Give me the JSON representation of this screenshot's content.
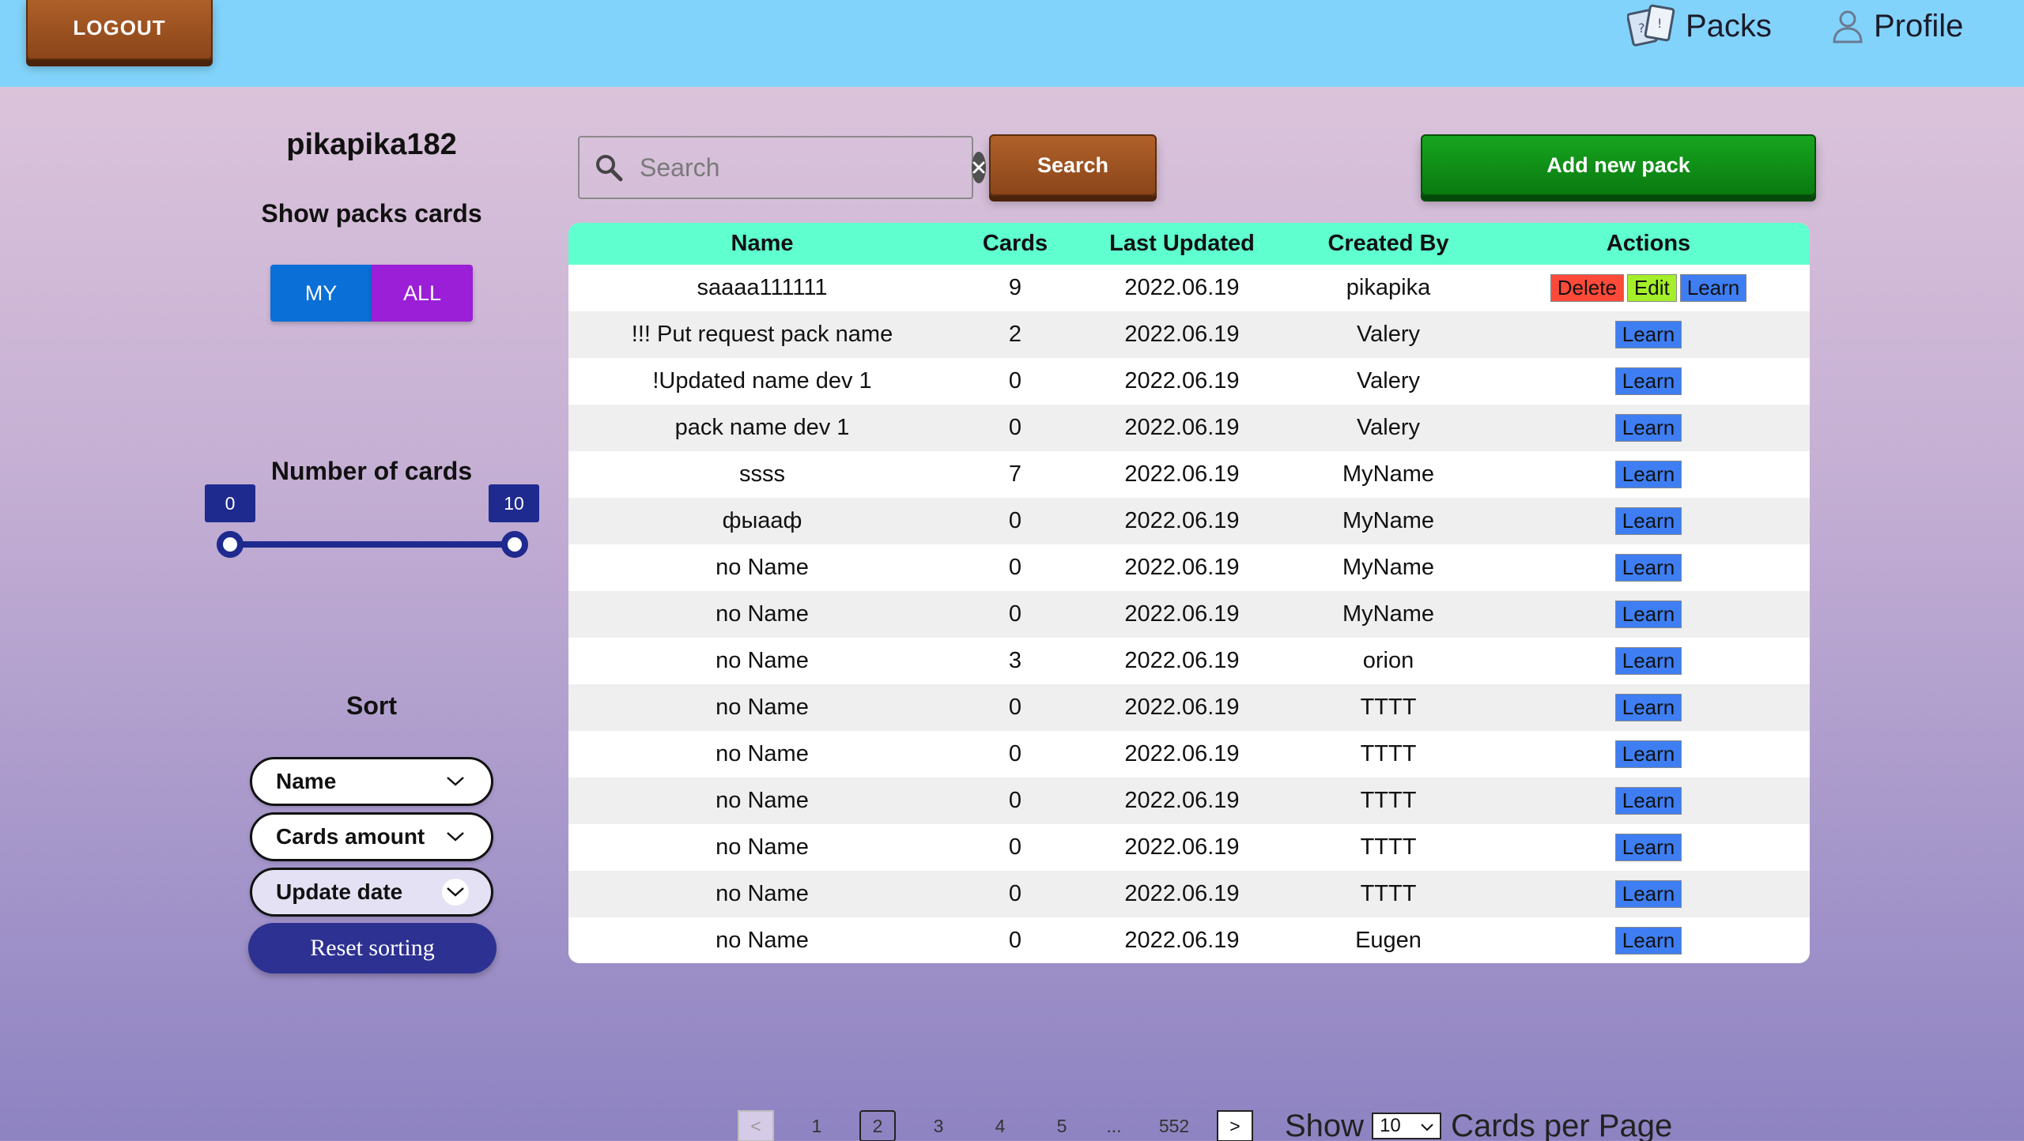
{
  "header": {
    "logout_label": "LOGOUT",
    "nav": [
      {
        "label": "Packs",
        "icon": "cards-icon"
      },
      {
        "label": "Profile",
        "icon": "user-icon"
      }
    ]
  },
  "sidebar": {
    "username": "pikapika182",
    "show_packs_title": "Show packs cards",
    "toggle": {
      "my": "MY",
      "all": "ALL"
    },
    "number_of_cards_title": "Number of cards",
    "slider": {
      "min": "0",
      "max": "10"
    },
    "sort_title": "Sort",
    "sort_options": [
      "Name",
      "Cards amount",
      "Update date"
    ],
    "reset_label": "Reset sorting"
  },
  "search": {
    "placeholder": "Search",
    "button_label": "Search"
  },
  "add_pack_label": "Add new pack",
  "table": {
    "headers": [
      "Name",
      "Cards",
      "Last Updated",
      "Created By",
      "Actions"
    ],
    "rows": [
      {
        "name": "saaaa111111",
        "cards": "9",
        "updated": "2022.06.19",
        "created_by": "pikapika",
        "actions": [
          "Delete",
          "Edit",
          "Learn"
        ]
      },
      {
        "name": "!!! Put request pack name",
        "cards": "2",
        "updated": "2022.06.19",
        "created_by": "Valery",
        "actions": [
          "Learn"
        ]
      },
      {
        "name": "!Updated name dev 1",
        "cards": "0",
        "updated": "2022.06.19",
        "created_by": "Valery",
        "actions": [
          "Learn"
        ]
      },
      {
        "name": "pack name dev 1",
        "cards": "0",
        "updated": "2022.06.19",
        "created_by": "Valery",
        "actions": [
          "Learn"
        ]
      },
      {
        "name": "ssss",
        "cards": "7",
        "updated": "2022.06.19",
        "created_by": "MyName",
        "actions": [
          "Learn"
        ]
      },
      {
        "name": "фыааф",
        "cards": "0",
        "updated": "2022.06.19",
        "created_by": "MyName",
        "actions": [
          "Learn"
        ]
      },
      {
        "name": "no Name",
        "cards": "0",
        "updated": "2022.06.19",
        "created_by": "MyName",
        "actions": [
          "Learn"
        ]
      },
      {
        "name": "no Name",
        "cards": "0",
        "updated": "2022.06.19",
        "created_by": "MyName",
        "actions": [
          "Learn"
        ]
      },
      {
        "name": "no Name",
        "cards": "3",
        "updated": "2022.06.19",
        "created_by": "orion",
        "actions": [
          "Learn"
        ]
      },
      {
        "name": "no Name",
        "cards": "0",
        "updated": "2022.06.19",
        "created_by": "TTTT",
        "actions": [
          "Learn"
        ]
      },
      {
        "name": "no Name",
        "cards": "0",
        "updated": "2022.06.19",
        "created_by": "TTTT",
        "actions": [
          "Learn"
        ]
      },
      {
        "name": "no Name",
        "cards": "0",
        "updated": "2022.06.19",
        "created_by": "TTTT",
        "actions": [
          "Learn"
        ]
      },
      {
        "name": "no Name",
        "cards": "0",
        "updated": "2022.06.19",
        "created_by": "TTTT",
        "actions": [
          "Learn"
        ]
      },
      {
        "name": "no Name",
        "cards": "0",
        "updated": "2022.06.19",
        "created_by": "TTTT",
        "actions": [
          "Learn"
        ]
      },
      {
        "name": "no Name",
        "cards": "0",
        "updated": "2022.06.19",
        "created_by": "Eugen",
        "actions": [
          "Learn"
        ]
      }
    ]
  },
  "pagination": {
    "prev": "<",
    "pages": [
      "1",
      "2",
      "3",
      "4",
      "5"
    ],
    "current": "2",
    "ellipsis": "...",
    "last": "552",
    "next": ">",
    "show_label": "Show",
    "per_page": "10",
    "per_page_suffix": "Cards per Page"
  },
  "colors": {
    "header_bg": "#82d3fb",
    "table_header_bg": "#5fffcf",
    "my_button": "#0a6fd6",
    "all_button": "#9b1fd6",
    "delete": "#ff4a3a",
    "edit": "#a4ef2a",
    "learn": "#3e7ef2",
    "reset_button": "#2d3192"
  }
}
